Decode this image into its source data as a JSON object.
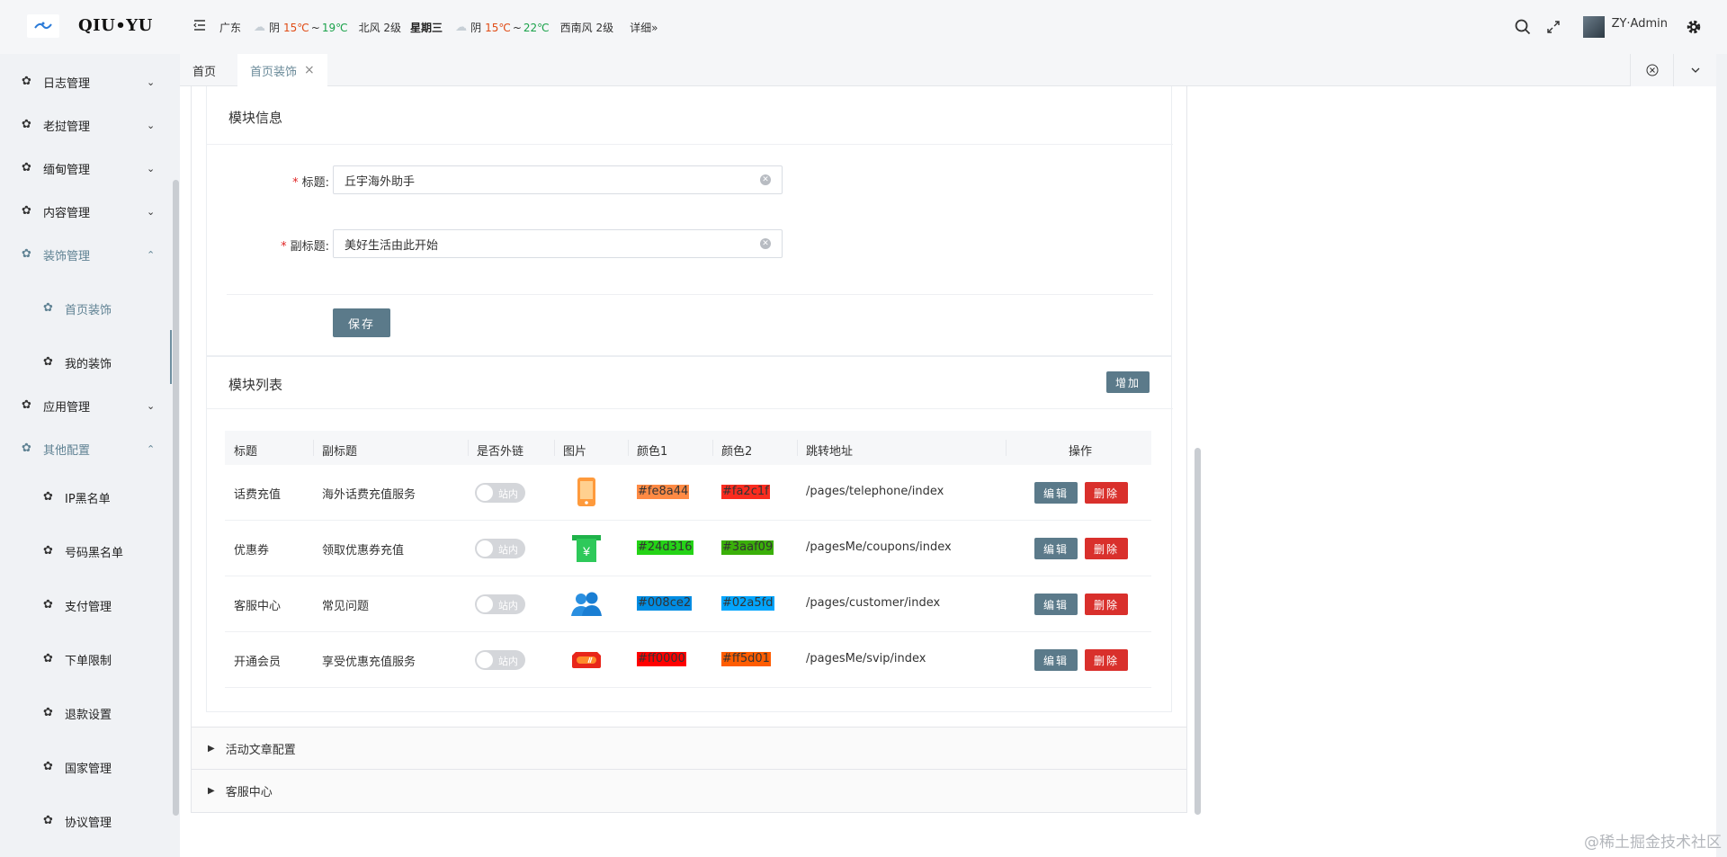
{
  "header": {
    "logo_text": "QIU•YU",
    "weather": {
      "city": "广东",
      "day1": {
        "cond": "阴",
        "low": "15℃",
        "tilde": "~",
        "high": "19℃",
        "wind": "北风 2级"
      },
      "weekday": "星期三",
      "day2": {
        "cond": "阴",
        "low": "15℃",
        "tilde": "~",
        "high": "22℃",
        "wind": "西南风 2级"
      },
      "more": "详细»"
    },
    "user": "ZY·Admin"
  },
  "sidebar": {
    "items": [
      {
        "label": "日志管理",
        "chevron": "⌄"
      },
      {
        "label": "老挝管理",
        "chevron": "⌄"
      },
      {
        "label": "缅甸管理",
        "chevron": "⌄"
      },
      {
        "label": "内容管理",
        "chevron": "⌄"
      },
      {
        "label": "装饰管理",
        "chevron": "⌃"
      },
      {
        "label": "首页装饰"
      },
      {
        "label": "我的装饰"
      },
      {
        "label": "应用管理",
        "chevron": "⌄"
      },
      {
        "label": "其他配置",
        "chevron": "⌃"
      },
      {
        "label": "IP黑名单"
      },
      {
        "label": "号码黑名单"
      },
      {
        "label": "支付管理"
      },
      {
        "label": "下单限制"
      },
      {
        "label": "退款设置"
      },
      {
        "label": "国家管理"
      },
      {
        "label": "协议管理"
      }
    ]
  },
  "tabs": [
    {
      "label": "首页"
    },
    {
      "label": "首页装饰",
      "close": "×"
    }
  ],
  "module_info": {
    "title": "模块信息",
    "fields": [
      {
        "label": "标题",
        "value": "丘宇海外助手"
      },
      {
        "label": "副标题",
        "value": "美好生活由此开始"
      }
    ],
    "required_mark": "*",
    "colon": ":",
    "save_label": "保存"
  },
  "module_list": {
    "title": "模块列表",
    "add_label": "增加",
    "columns": [
      "标题",
      "副标题",
      "是否外链",
      "图片",
      "颜色1",
      "颜色2",
      "跳转地址",
      "操作"
    ],
    "switch_text": "站内",
    "edit_label": "编辑",
    "delete_label": "删除",
    "rows": [
      {
        "title": "话费充值",
        "subtitle": "海外话费充值服务",
        "image": "phone-icon",
        "color1": "#fe8a44",
        "color2": "#fa2c1f",
        "url": "/pages/telephone/index"
      },
      {
        "title": "优惠券",
        "subtitle": "领取优惠券充值",
        "image": "coupon-icon",
        "color1": "#24d316",
        "color2": "#3aaf09",
        "url": "/pagesMe/coupons/index"
      },
      {
        "title": "客服中心",
        "subtitle": "常见问题",
        "image": "customer-service-icon",
        "color1": "#008ce2",
        "color2": "#02a5fd",
        "url": "/pages/customer/index"
      },
      {
        "title": "开通会员",
        "subtitle": "享受优惠充值服务",
        "image": "vip-icon",
        "color1": "#ff0000",
        "color2": "#ff5d01",
        "url": "/pagesMe/svip/index"
      }
    ]
  },
  "collapses": [
    {
      "label": "活动文章配置"
    },
    {
      "label": "客服中心"
    }
  ],
  "watermark": "@稀土掘金技术社区"
}
